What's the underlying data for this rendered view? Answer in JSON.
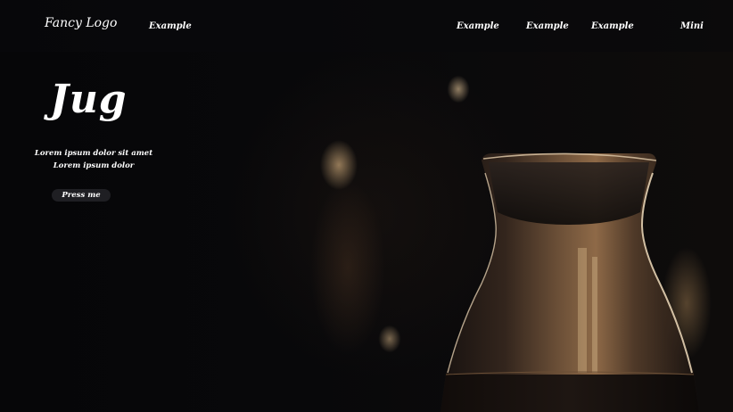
{
  "nav": {
    "logo": "Fancy Logo",
    "links": [
      "Example",
      "Example",
      "Example",
      "Example"
    ],
    "mini": "Mini"
  },
  "hero": {
    "title": "Jug",
    "subtitle_line1": "Lorem ipsum dolor sit amet",
    "subtitle_line2": "Lorem ipsum dolor",
    "button_label": "Press me"
  },
  "colors": {
    "background": "#070708",
    "text": "#ffffff",
    "button_bg": "#1f1f23"
  }
}
